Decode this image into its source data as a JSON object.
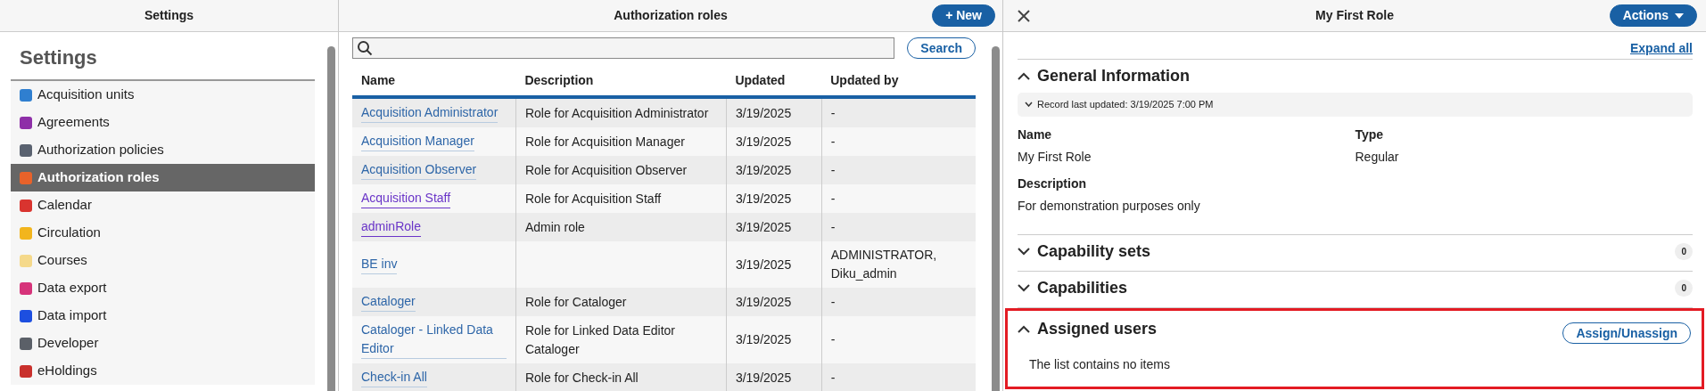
{
  "settings_pane": {
    "header": "Settings",
    "heading": "Settings",
    "items": [
      {
        "label": "Acquisition units",
        "color": "#2f7fd0",
        "selected": false
      },
      {
        "label": "Agreements",
        "color": "#8e2fa8",
        "selected": false
      },
      {
        "label": "Authorization policies",
        "color": "#5a6270",
        "selected": false
      },
      {
        "label": "Authorization roles",
        "color": "#e8622a",
        "selected": true
      },
      {
        "label": "Calendar",
        "color": "#d9342f",
        "selected": false
      },
      {
        "label": "Circulation",
        "color": "#f2b51d",
        "selected": false
      },
      {
        "label": "Courses",
        "color": "#f5d98a",
        "selected": false
      },
      {
        "label": "Data export",
        "color": "#d6337a",
        "selected": false
      },
      {
        "label": "Data import",
        "color": "#1d4fe0",
        "selected": false
      },
      {
        "label": "Developer",
        "color": "#5b6068",
        "selected": false
      },
      {
        "label": "eHoldings",
        "color": "#c9302c",
        "selected": false
      }
    ]
  },
  "roles_pane": {
    "header": "Authorization roles",
    "new_button": "+ New",
    "search_button": "Search",
    "columns": [
      "Name",
      "Description",
      "Updated",
      "Updated by"
    ],
    "rows": [
      {
        "name": "Acquisition Administrator",
        "visited": false,
        "description": "Role for Acquisition Administrator",
        "updated": "3/19/2025",
        "updated_by": "-"
      },
      {
        "name": "Acquisition Manager",
        "visited": false,
        "description": "Role for Acquisition Manager",
        "updated": "3/19/2025",
        "updated_by": "-"
      },
      {
        "name": "Acquisition Observer",
        "visited": false,
        "description": "Role for Acquisition Observer",
        "updated": "3/19/2025",
        "updated_by": "-"
      },
      {
        "name": "Acquisition Staff",
        "visited": true,
        "description": "Role for Acquisition Staff",
        "updated": "3/19/2025",
        "updated_by": "-"
      },
      {
        "name": "adminRole",
        "visited": true,
        "description": "Admin role",
        "updated": "3/19/2025",
        "updated_by": "-"
      },
      {
        "name": "BE inv",
        "visited": false,
        "updated": "3/19/2025",
        "updated_by": "ADMINISTRATOR, Diku_admin"
      },
      {
        "name": "Cataloger",
        "visited": false,
        "description": "Role for Cataloger",
        "updated": "3/19/2025",
        "updated_by": "-"
      },
      {
        "name": "Cataloger - Linked Data Editor",
        "visited": false,
        "description": "Role for Linked Data Editor Cataloger",
        "updated": "3/19/2025",
        "updated_by": "-"
      },
      {
        "name": "Check-in All",
        "visited": false,
        "description": "Role for Check-in All",
        "updated": "3/19/2025",
        "updated_by": "-"
      }
    ]
  },
  "detail_pane": {
    "title": "My First Role",
    "actions_button": "Actions",
    "expand_all": "Expand all",
    "sections": [
      {
        "kind": "info",
        "title": "General Information",
        "expanded": true,
        "record_meta": {
          "label": "Record last updated: 3/19/2025 7:00 PM",
          "expanded": false
        },
        "field_rows": [
          [
            {
              "label": "Name",
              "value": "My First Role"
            },
            {
              "label": "Type",
              "value": "Regular"
            }
          ],
          [
            {
              "label": "Description",
              "value": "For demonstration purposes only"
            }
          ]
        ]
      },
      {
        "kind": "count",
        "title": "Capability sets",
        "expanded": false,
        "count": "0"
      },
      {
        "kind": "count",
        "title": "Capabilities",
        "expanded": false,
        "count": "0"
      },
      {
        "kind": "users",
        "title": "Assigned users",
        "expanded": true,
        "highlighted": true,
        "button": "Assign/Unassign",
        "empty_message": "The list contains no items"
      }
    ]
  }
}
